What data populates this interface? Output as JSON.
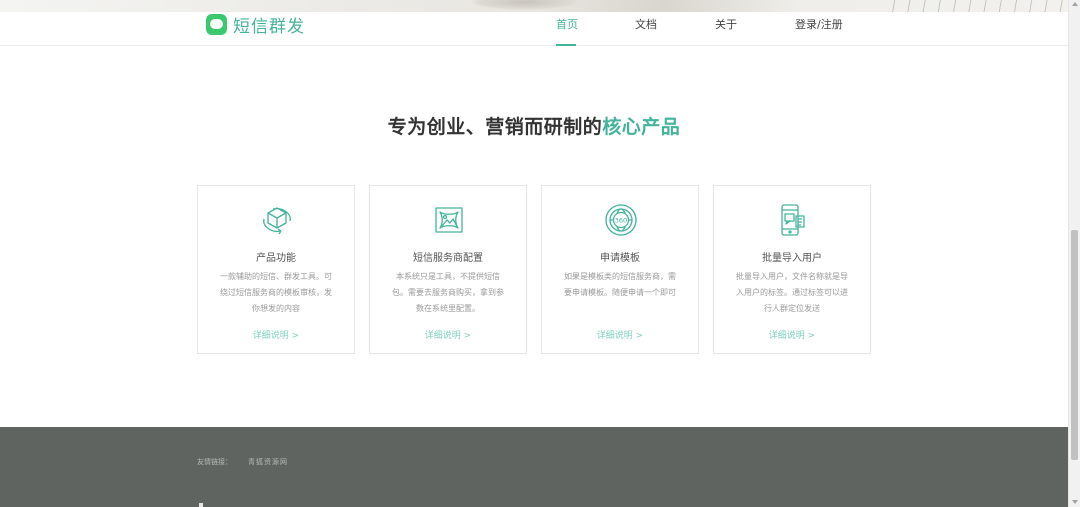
{
  "header": {
    "brand": "短信群发",
    "nav": [
      {
        "label": "首页",
        "active": true
      },
      {
        "label": "文档",
        "active": false
      },
      {
        "label": "关于",
        "active": false
      },
      {
        "label": "登录/注册",
        "active": false
      }
    ]
  },
  "section": {
    "title_main": "专为创业、营销而研制的",
    "title_highlight": "核心产品"
  },
  "cards": [
    {
      "icon": "cube-icon",
      "title": "产品功能",
      "desc": "一款辅助的短信、群发工具。可绕过短信服务商的模板审核，发你想发的内容",
      "more": "详细说明 >"
    },
    {
      "icon": "image-frame-icon",
      "title": "短信服务商配置",
      "desc": "本系统只是工具，不提供短信包。需要去服务商购买，拿到参数在系统里配置。",
      "more": "详细说明 >"
    },
    {
      "icon": "360-globe-icon",
      "title": "申请模板",
      "desc": "如果是模板类的短信服务商，需要申请模板。随便申请一个即可",
      "more": "详细说明 >"
    },
    {
      "icon": "phone-chat-icon",
      "title": "批量导入用户",
      "desc": "批量导入用户，文件名称就是导入用户的标签。通过标签可以进行人群定位发送",
      "more": "详细说明 >"
    }
  ],
  "footer": {
    "links_label": "友情链接：",
    "links": [
      "青狐资源网"
    ]
  },
  "colors": {
    "accent": "#43b39b",
    "brand_icon": "#3bc96d",
    "footer_bg": "#5f6460"
  }
}
